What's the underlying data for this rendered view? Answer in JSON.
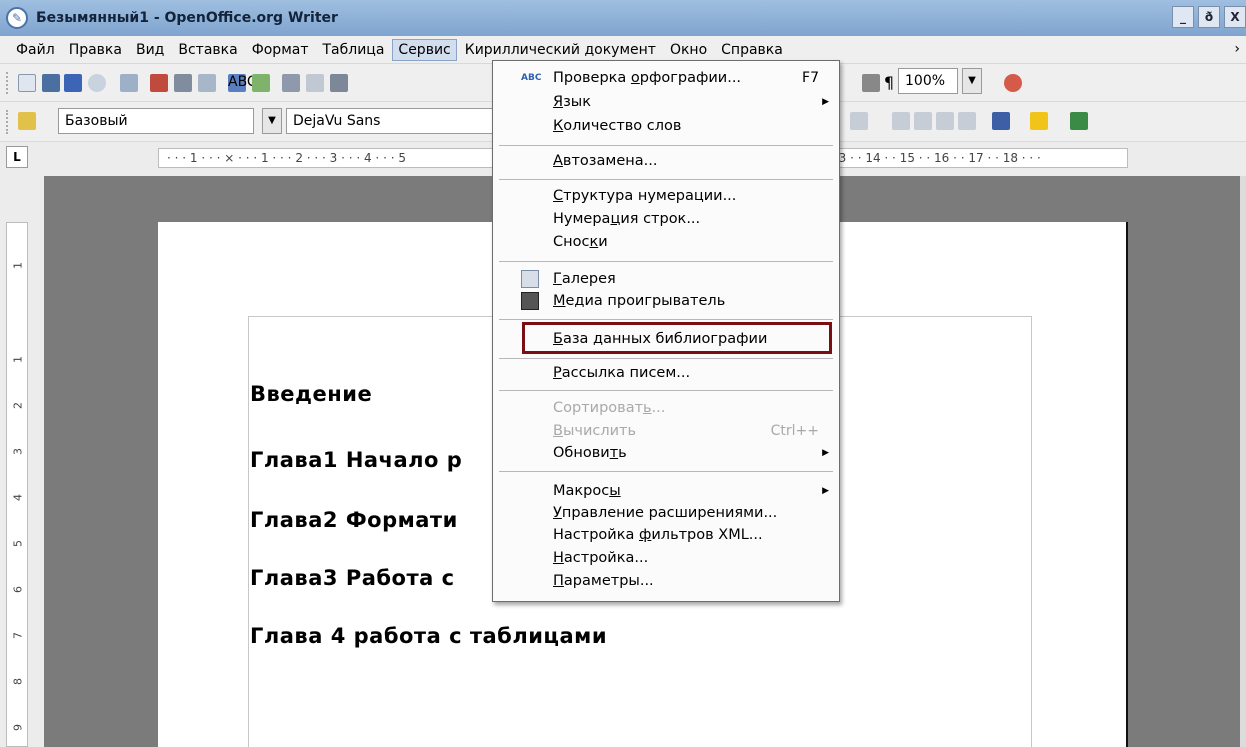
{
  "window": {
    "title": "Безымянный1 - OpenOffice.org Writer",
    "controls": [
      "_",
      "ð",
      "X"
    ]
  },
  "menubar": {
    "items": [
      "Файл",
      "Правка",
      "Вид",
      "Вставка",
      "Формат",
      "Таблица",
      "Сервис",
      "Кириллический документ",
      "Окно",
      "Справка"
    ],
    "active": "Сервис",
    "overflow": "›"
  },
  "toolbar": {
    "zoom": "100%",
    "paragraph_style": "Базовый",
    "font_name": "DejaVu Sans",
    "pilcrow": "¶"
  },
  "ruler": {
    "corner": "L",
    "left_marks": "· · · 1 · · · ⨯ · · · 1 · · · 2 · · · 3 · · · 4 · · · 5",
    "right_marks": "13 · · 14 · · 15 · · 16 · · 17 · · 18 · · ·",
    "vertical_marks": [
      "1",
      "1",
      "2",
      "3",
      "4",
      "5",
      "6",
      "7",
      "8",
      "9"
    ]
  },
  "document": {
    "headings": [
      "Введение",
      "Глава1 Начало р",
      "Глава2 Формати",
      "Глава3 Работа с",
      "Глава 4 работа с таблицами"
    ]
  },
  "service_menu": {
    "groups": [
      [
        {
          "pre": "Проверка ",
          "u": "о",
          "post": "рфографии...",
          "shortcut": "F7",
          "icon": "ABC"
        },
        {
          "pre": "",
          "u": "Я",
          "post": "зык",
          "submenu": true
        },
        {
          "pre": "",
          "u": "К",
          "post": "оличество слов"
        }
      ],
      [
        {
          "pre": "",
          "u": "А",
          "post": "втозамена..."
        }
      ],
      [
        {
          "pre": "",
          "u": "С",
          "post": "труктура нумерации..."
        },
        {
          "pre": "Нумера",
          "u": "ц",
          "post": "ия строк..."
        },
        {
          "pre": "Снос",
          "u": "к",
          "post": "и"
        }
      ],
      [
        {
          "pre": "",
          "u": "Г",
          "post": "алерея",
          "icon": "gallery"
        },
        {
          "pre": "",
          "u": "М",
          "post": "едиа проигрыватель",
          "icon": "media"
        }
      ],
      [
        {
          "pre": "",
          "u": "Б",
          "post": "аза данных библиографии",
          "highlighted": true
        }
      ],
      [
        {
          "pre": "",
          "u": "Р",
          "post": "ассылка писем..."
        }
      ],
      [
        {
          "pre": "Сортироват",
          "u": "ь",
          "post": "...",
          "disabled": true
        },
        {
          "pre": "",
          "u": "В",
          "post": "ычислить",
          "shortcut": "Ctrl++",
          "disabled": true
        },
        {
          "pre": "Обнови",
          "u": "т",
          "post": "ь",
          "submenu": true
        }
      ],
      [
        {
          "pre": "Макрос",
          "u": "ы",
          "post": "",
          "submenu": true
        },
        {
          "pre": "",
          "u": "У",
          "post": "правление расширениями..."
        },
        {
          "pre": "Настройка ",
          "u": "ф",
          "post": "ильтров XML..."
        },
        {
          "pre": "",
          "u": "Н",
          "post": "астройка..."
        },
        {
          "pre": "",
          "u": "П",
          "post": "араметры..."
        }
      ]
    ]
  },
  "colors": {
    "highlight_border": "#7a0f13",
    "titlebar": "#8fb2da"
  }
}
